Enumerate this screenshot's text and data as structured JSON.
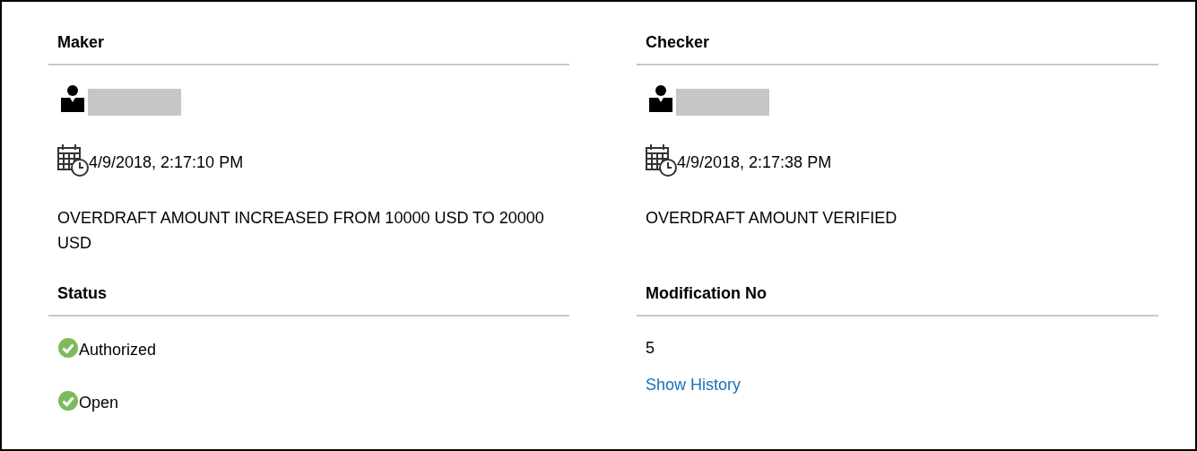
{
  "sections": [
    {
      "title": "Maker",
      "user": {
        "redacted": true
      },
      "timestamp": "4/9/2018, 2:17:10 PM",
      "description": "OVERDRAFT AMOUNT INCREASED FROM 10000 USD TO 20000 USD"
    },
    {
      "title": "Checker",
      "user": {
        "redacted": true
      },
      "timestamp": "4/9/2018, 2:17:38 PM",
      "description": "OVERDRAFT AMOUNT VERIFIED"
    }
  ],
  "status": {
    "title": "Status",
    "items": [
      {
        "label": "Authorized",
        "checked": true
      },
      {
        "label": "Open",
        "checked": true
      }
    ]
  },
  "modification": {
    "title": "Modification No",
    "value": "5",
    "link": "Show History"
  }
}
